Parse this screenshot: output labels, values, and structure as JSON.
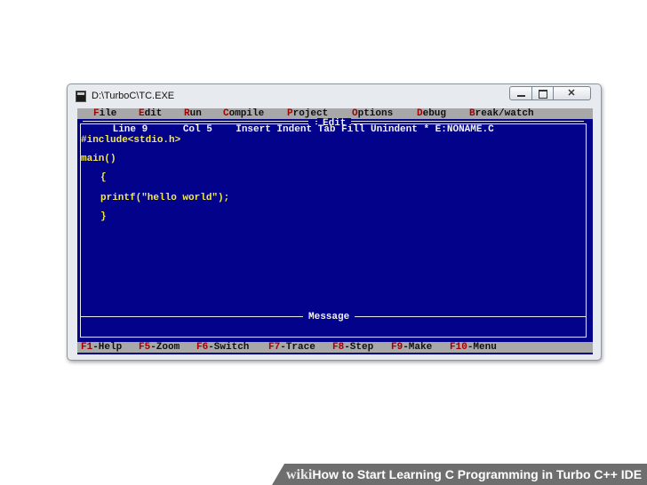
{
  "window": {
    "title": "D:\\TurboC\\TC.EXE",
    "controls": {
      "minimize": "",
      "maximize": "",
      "close": ""
    }
  },
  "menu": {
    "items": [
      {
        "hotkey": "F",
        "rest": "ile"
      },
      {
        "hotkey": "E",
        "rest": "dit"
      },
      {
        "hotkey": "R",
        "rest": "un"
      },
      {
        "hotkey": "C",
        "rest": "ompile"
      },
      {
        "hotkey": "P",
        "rest": "roject"
      },
      {
        "hotkey": "O",
        "rest": "ptions"
      },
      {
        "hotkey": "D",
        "rest": "ebug"
      },
      {
        "hotkey": "B",
        "rest": "reak/watch"
      }
    ]
  },
  "editor": {
    "frame_title": "Edit",
    "status_line": "      Line 9      Col 5    Insert Indent Tab Fill Unindent * E:NONAME.C",
    "code_lines": [
      "#include<stdio.h>",
      "main()",
      "{",
      "printf(\"hello world\");",
      "}"
    ]
  },
  "message": {
    "title": "Message"
  },
  "function_keys": [
    {
      "key": "F1",
      "label": "-Help"
    },
    {
      "key": "F5",
      "label": "-Zoom"
    },
    {
      "key": "F6",
      "label": "-Switch"
    },
    {
      "key": "F7",
      "label": "-Trace"
    },
    {
      "key": "F8",
      "label": "-Step"
    },
    {
      "key": "F9",
      "label": "-Make"
    },
    {
      "key": "F10",
      "label": "-Menu"
    }
  ],
  "caption": {
    "brand": "wiki",
    "how": "How",
    "text": " to Start Learning C Programming in Turbo C++ IDE"
  },
  "colors": {
    "screen_bg": "#02028b",
    "menu_bg": "#a8a8a8",
    "hotkey": "#a40000",
    "code_text": "#f4e94a",
    "frame_text": "#f2f2f2"
  }
}
